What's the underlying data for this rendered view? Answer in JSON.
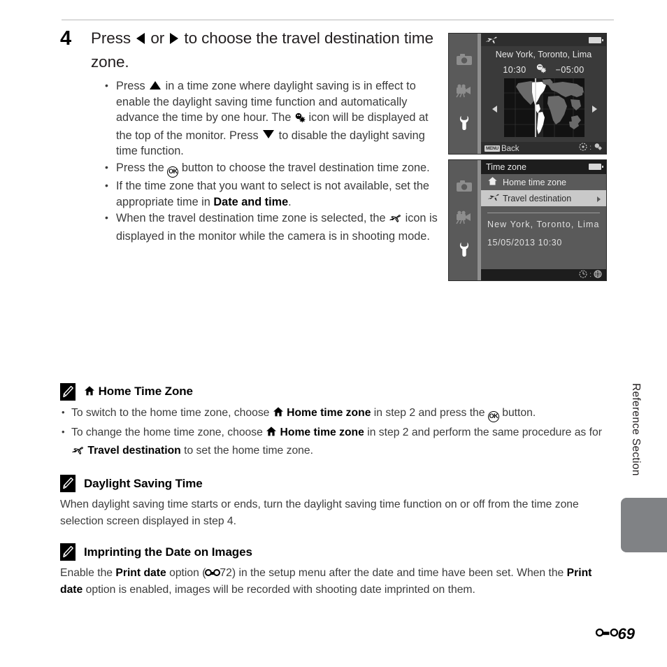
{
  "step": {
    "number": "4",
    "title_prefix": "Press ",
    "title_mid": " or ",
    "title_suffix": " to choose the travel destination time zone.",
    "bullets": [
      {
        "parts": [
          {
            "t": "text",
            "v": "Press "
          },
          {
            "t": "icon",
            "v": "triangle-up-icon"
          },
          {
            "t": "text",
            "v": " in a time zone where daylight saving is in effect to enable the daylight saving time function and automatically advance the time by one hour. The "
          },
          {
            "t": "icon",
            "v": "daylight-saving-icon"
          },
          {
            "t": "text",
            "v": " icon will be displayed at the top of the monitor. Press "
          },
          {
            "t": "icon",
            "v": "triangle-down-icon"
          },
          {
            "t": "text",
            "v": " to disable the daylight saving time function."
          }
        ]
      },
      {
        "parts": [
          {
            "t": "text",
            "v": "Press the "
          },
          {
            "t": "icon",
            "v": "ok-button-icon"
          },
          {
            "t": "text",
            "v": " button to choose the travel destination time zone."
          }
        ]
      },
      {
        "parts": [
          {
            "t": "text",
            "v": "If the time zone that you want to select is not available, set the appropriate time in "
          },
          {
            "t": "bold",
            "v": "Date and time"
          },
          {
            "t": "text",
            "v": "."
          }
        ]
      },
      {
        "parts": [
          {
            "t": "text",
            "v": "When the travel destination time zone is selected, the "
          },
          {
            "t": "icon",
            "v": "travel-destination-icon"
          },
          {
            "t": "text",
            "v": " icon is displayed in the monitor while the camera is in shooting mode."
          }
        ]
      }
    ]
  },
  "screen_map": {
    "top_icon": "airplane-icon",
    "battery": "battery-icon",
    "city": "New York, Toronto, Lima",
    "time": "10:30",
    "dst_icon": "daylight-saving-icon",
    "utc_offset": "−05:00",
    "left_arrow": "chevron-left-icon",
    "right_arrow": "chevron-right-icon",
    "menu_key": "MENU",
    "back_label": "Back",
    "hint_left_icon": "multi-selector-icon",
    "hint_separator": ":",
    "hint_right_icon": "daylight-saving-icon",
    "sidebar_icons": [
      "camera-icon",
      "movie-icon",
      "setup-wrench-icon"
    ]
  },
  "screen_menu": {
    "title": "Time zone",
    "battery": "battery-icon",
    "rows": [
      {
        "icon": "home-icon",
        "label": "Home time zone",
        "selected": false,
        "arrow": false
      },
      {
        "icon": "airplane-icon",
        "label": "Travel destination",
        "selected": true,
        "arrow": true
      }
    ],
    "city": "New York, Toronto, Lima",
    "date_time": "15/05/2013  10:30",
    "hint_left_icon": "clock-icon",
    "hint_separator": ":",
    "hint_right_icon": "globe-icon",
    "sidebar_icons": [
      "camera-icon",
      "movie-icon",
      "setup-wrench-icon"
    ]
  },
  "notes": [
    {
      "icon": "pencil-note-icon",
      "title_icon": "home-icon",
      "title": "Home Time Zone",
      "bullets": [
        {
          "parts": [
            {
              "t": "text",
              "v": "To switch to the home time zone, choose "
            },
            {
              "t": "icon",
              "v": "home-icon"
            },
            {
              "t": "bold",
              "v": " Home time zone"
            },
            {
              "t": "text",
              "v": " in step 2 and press the "
            },
            {
              "t": "icon",
              "v": "ok-button-icon"
            },
            {
              "t": "text",
              "v": " button."
            }
          ]
        },
        {
          "parts": [
            {
              "t": "text",
              "v": "To change the home time zone, choose "
            },
            {
              "t": "icon",
              "v": "home-icon"
            },
            {
              "t": "bold",
              "v": " Home time zone"
            },
            {
              "t": "text",
              "v": " in step 2 and perform the same procedure as for "
            },
            {
              "t": "icon",
              "v": "travel-destination-icon"
            },
            {
              "t": "bold",
              "v": " Travel destination"
            },
            {
              "t": "text",
              "v": " to set the home time zone."
            }
          ]
        }
      ]
    },
    {
      "icon": "pencil-note-icon",
      "title": "Daylight Saving Time",
      "paragraphs": [
        {
          "parts": [
            {
              "t": "text",
              "v": "When daylight saving time starts or ends, turn the daylight saving time function on or off from the time zone selection screen displayed in step 4."
            }
          ]
        }
      ]
    },
    {
      "icon": "pencil-note-icon",
      "title": "Imprinting the Date on Images",
      "paragraphs": [
        {
          "parts": [
            {
              "t": "text",
              "v": "Enable the "
            },
            {
              "t": "bold",
              "v": "Print date"
            },
            {
              "t": "text",
              "v": " option ("
            },
            {
              "t": "icon",
              "v": "reference-mark-icon"
            },
            {
              "t": "text",
              "v": "72) in the setup menu after the date and time have been set. When the "
            },
            {
              "t": "bold",
              "v": "Print date"
            },
            {
              "t": "text",
              "v": " option is enabled, images will be recorded with shooting date imprinted on them."
            }
          ]
        }
      ]
    }
  ],
  "side_tab": {
    "label": "Reference Section",
    "tab_color": "#808285"
  },
  "footer": {
    "page_mark_icon": "reference-mark-icon",
    "page_number": "69"
  },
  "colors": {
    "text": "#3b3b3b",
    "heading": "#000000",
    "screen_sidebar": "#5a5a5a",
    "screen_body": "#3a3a3a",
    "screen_bar": "#2e2e2e",
    "selected_row": "#c9c9c9",
    "tab_gray": "#808285"
  }
}
